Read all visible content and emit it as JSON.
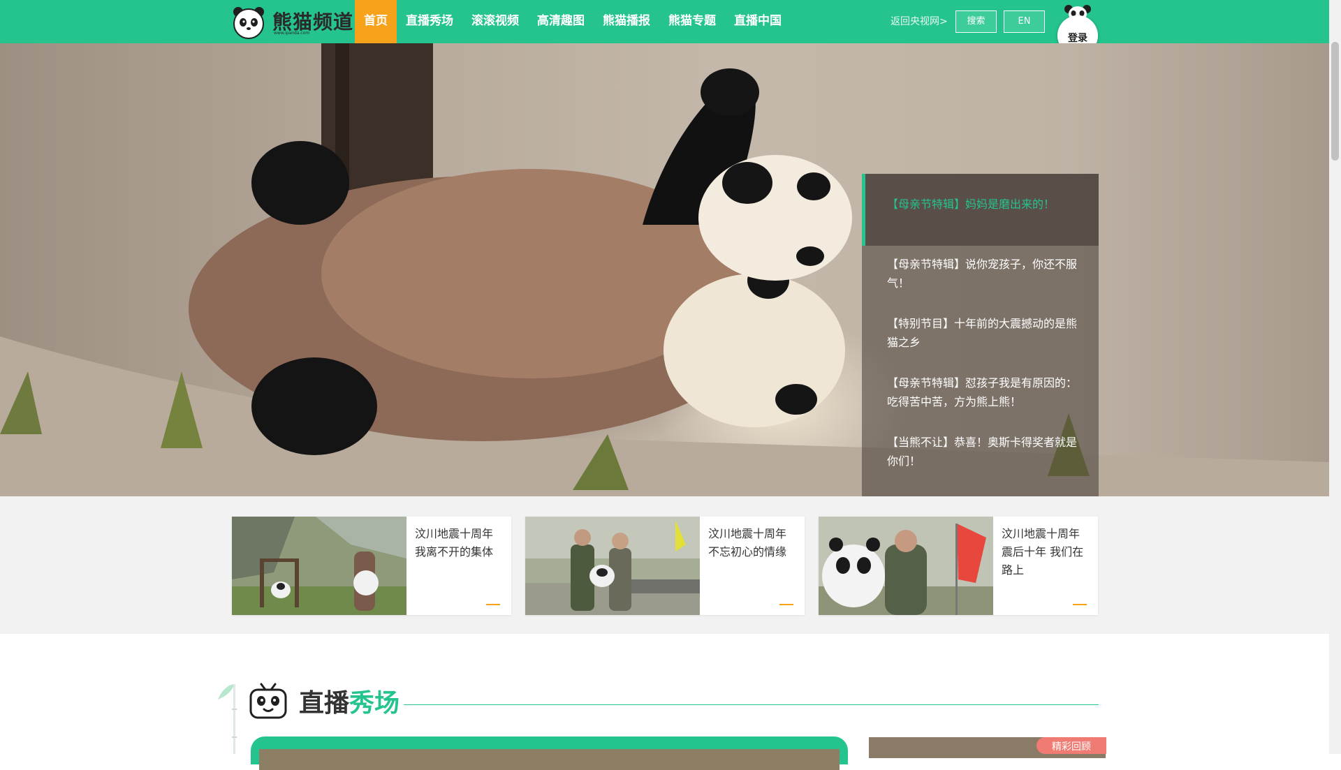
{
  "header": {
    "logo_text": "熊猫频道",
    "logo_url_text": "www.ipanda.com",
    "nav": [
      {
        "label": "首页",
        "active": true
      },
      {
        "label": "直播秀场",
        "active": false
      },
      {
        "label": "滚滚视频",
        "active": false
      },
      {
        "label": "高清趣图",
        "active": false
      },
      {
        "label": "熊猫播报",
        "active": false
      },
      {
        "label": "熊猫专题",
        "active": false
      },
      {
        "label": "直播中国",
        "active": false
      }
    ],
    "back_link": "返回央视网>",
    "search_label": "搜索",
    "lang_label": "EN",
    "login_label": "登录"
  },
  "hero": {
    "news": [
      {
        "title": "【母亲节特辑】妈妈是磨出来的！",
        "active": true
      },
      {
        "title": "【母亲节特辑】说你宠孩子，你还不服气！",
        "active": false
      },
      {
        "title": "【特别节目】十年前的大震撼动的是熊猫之乡",
        "active": false
      },
      {
        "title": "【母亲节特辑】怼孩子我是有原因的：吃得苦中苦，方为熊上熊！",
        "active": false
      },
      {
        "title": "【当熊不让】恭喜！奥斯卡得奖者就是你们！",
        "active": false
      }
    ]
  },
  "featured": [
    {
      "title": "汶川地震十周年 我离不开的集体"
    },
    {
      "title": "汶川地震十周年 不忘初心的情缘"
    },
    {
      "title": "汶川地震十周年 震后十年 我们在路上"
    }
  ],
  "section": {
    "title_part1": "直播",
    "title_part2": "秀场",
    "replay_tag": "精彩回顾"
  },
  "colors": {
    "brand_green": "#25c38e",
    "active_orange": "#f6a21b",
    "tag_red": "#f07b72"
  }
}
